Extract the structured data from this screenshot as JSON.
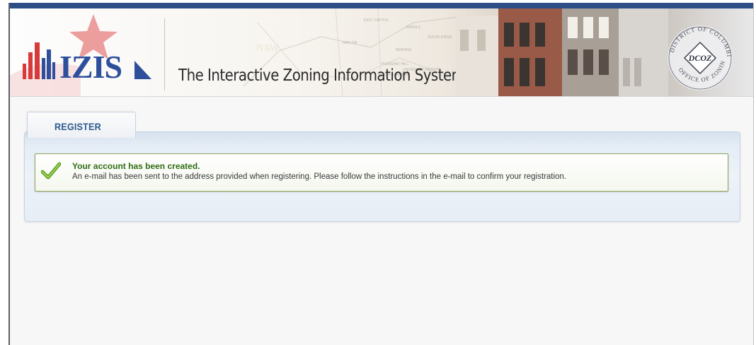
{
  "header": {
    "logo_text": "IZIS",
    "site_title": "The Interactive Zoning Information System",
    "seal": {
      "arc_top": "DISTRICT OF COLUMBIA",
      "arc_bottom": "OFFICE OF ZONING",
      "center": "DCOZ"
    },
    "map_labels": [
      "EAST CAPITOL",
      "NAYLOR",
      "RANDLE",
      "BENNING",
      "PLEASANT HILL",
      "NORTH GARDENS",
      "UNIVERSITY HEIGHTS",
      "SOUTH RIDGE"
    ]
  },
  "tab": {
    "label": "REGISTER"
  },
  "message": {
    "icon": "checkmark-icon",
    "title": "Your account has been created.",
    "body": "An e-mail has been sent to the address provided when registering. Please follow the instructions in the e-mail to confirm your registration."
  },
  "colors": {
    "brand_blue": "#2e4f9c",
    "brand_red": "#d63a3a",
    "success_green": "#2f6d12",
    "panel_blue": "#e4ecf5"
  }
}
